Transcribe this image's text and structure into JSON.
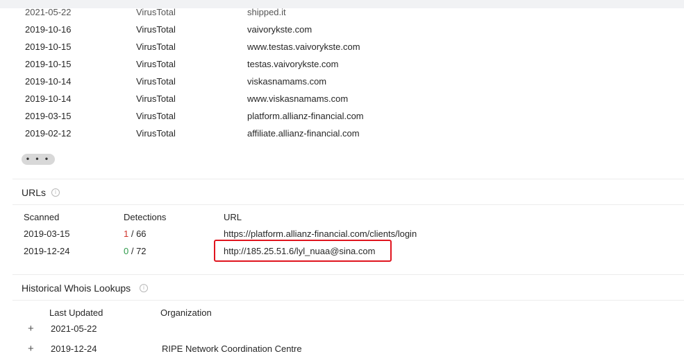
{
  "resolutions": [
    {
      "date": "2021-05-22",
      "source": "VirusTotal",
      "host": "shipped.it"
    },
    {
      "date": "2019-10-16",
      "source": "VirusTotal",
      "host": "vaivorykste.com"
    },
    {
      "date": "2019-10-15",
      "source": "VirusTotal",
      "host": "www.testas.vaivorykste.com"
    },
    {
      "date": "2019-10-15",
      "source": "VirusTotal",
      "host": "testas.vaivorykste.com"
    },
    {
      "date": "2019-10-14",
      "source": "VirusTotal",
      "host": "viskasnamams.com"
    },
    {
      "date": "2019-10-14",
      "source": "VirusTotal",
      "host": "www.viskasnamams.com"
    },
    {
      "date": "2019-03-15",
      "source": "VirusTotal",
      "host": "platform.allianz-financial.com"
    },
    {
      "date": "2019-02-12",
      "source": "VirusTotal",
      "host": "affiliate.allianz-financial.com"
    }
  ],
  "more_label": "• • •",
  "urls": {
    "title": "URLs",
    "headers": {
      "scanned": "Scanned",
      "detections": "Detections",
      "url": "URL"
    },
    "rows": [
      {
        "scanned": "2019-03-15",
        "detected": "1",
        "total": " / 66",
        "url": "https://platform.allianz-financial.com/clients/login"
      },
      {
        "scanned": "2019-12-24",
        "detected": "0",
        "total": " / 72",
        "url": "http://185.25.51.6/lyl_nuaa@sina.com"
      }
    ]
  },
  "whois": {
    "title": "Historical Whois Lookups",
    "headers": {
      "last_updated": "Last Updated",
      "organization": "Organization"
    },
    "rows": [
      {
        "last_updated": "2021-05-22",
        "organization": ""
      },
      {
        "last_updated": "2019-12-24",
        "organization": "RIPE Network Coordination Centre"
      }
    ]
  },
  "icons": {
    "info": "info-icon",
    "expand": "plus-icon"
  },
  "colors": {
    "detected_positive": "#d0342c",
    "detected_zero": "#2e9a4a",
    "highlight": "#e0141e"
  }
}
